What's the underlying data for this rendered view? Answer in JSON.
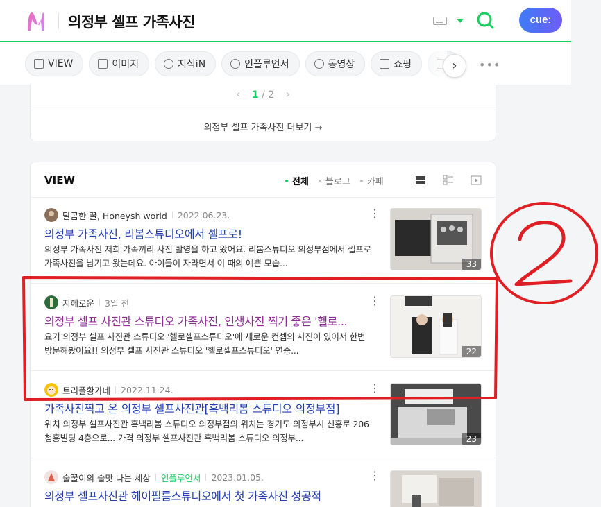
{
  "header": {
    "query": "의정부 셀프 가족사진",
    "cue_label": "cue:"
  },
  "tabs": [
    {
      "label": "VIEW",
      "icon": "document-icon"
    },
    {
      "label": "이미지",
      "icon": "image-icon"
    },
    {
      "label": "지식iN",
      "icon": "q-icon"
    },
    {
      "label": "인플루언서",
      "icon": "person-icon"
    },
    {
      "label": "동영상",
      "icon": "play-icon"
    },
    {
      "label": "쇼핑",
      "icon": "bag-icon"
    },
    {
      "label": "",
      "icon": "news-icon"
    }
  ],
  "pager": {
    "current": "1",
    "separator": "/",
    "total": "2"
  },
  "more_link": "의정부 셀프 가족사진 더보기 →",
  "view": {
    "title": "VIEW",
    "filters": [
      "전체",
      "블로그",
      "카페"
    ],
    "items": [
      {
        "author": "달콤한 꿀, Honeysh world",
        "date": "2022.06.23.",
        "title": "의정부 가족사진, 리봄스튜디오에서 셀프로!",
        "desc": "의정부 가족사진 저희 가족끼리 사진 촬영을 하고 왔어요. 리봄스튜디오 의정부점에서 셀프로 가족사진을 남기고 왔는데요. 아이들이 자라면서 이 때의 예쁜 모습...",
        "count": "33"
      },
      {
        "author": "지혜로운",
        "date": "3일 전",
        "title": "의정부 셀프 사진관 스튜디오 가족사진, 인생사진 찍기 좋은 '헬로...",
        "desc": "요기 의정부 셀프 사진관 스튜디오 '헬로셀프스튜디오'에 새로운 컨셉의 사진이 있어서 한번 방문해봤어요!! 의정부 셀프 사진관 스튜디오 '헬로셀프스튜디오' 연중...",
        "count": "22"
      },
      {
        "author": "트리플황가네",
        "date": "2022.11.24.",
        "title": "가족사진찍고 온 의정부 셀프사진관[흑백리봄 스튜디오 의정부점]",
        "desc": "위치 의정부 셀프사진관 흑백리봄 스튜디오 의정부점의 위치는 경기도 의정부시 신흥로 206 청홍빌딩 4층으로... 가격 의정부 셀프사진관 흑백리봄 스튜디오 의정부...",
        "count": "23"
      },
      {
        "author": "술꿀이의 술맛 나는 세상",
        "badge": "인플루언서",
        "date": "2023.01.05.",
        "title": "의정부 셀프사진관 헤이필름스튜디오에서 첫 가족사진 성공적",
        "desc": "",
        "count": ""
      }
    ]
  },
  "annotation": {
    "text": "2",
    "color": "#e01f25"
  },
  "colors": {
    "brand_green": "#19ce60",
    "link_blue": "#2440b3",
    "visited_purple": "#8e2d95"
  }
}
